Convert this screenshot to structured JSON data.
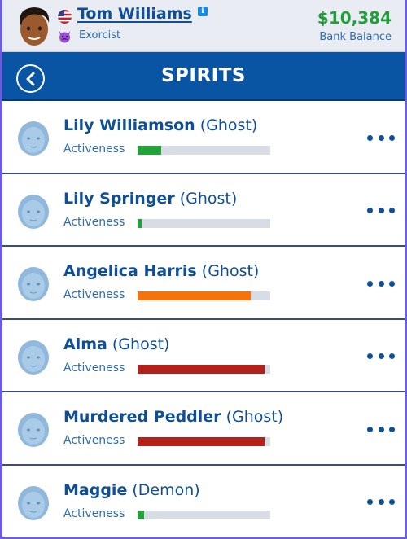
{
  "profile": {
    "name": "Tom Williams",
    "job": "Exorcist",
    "info_icon": "i",
    "flag_icon": "us-flag-icon",
    "job_icon": "devil-emoji-icon",
    "balance": "$10,384",
    "balance_label": "Bank Balance"
  },
  "header": {
    "title": "SPIRITS",
    "back_icon": "chevron-left-circle-icon"
  },
  "colors": {
    "brand_blue": "#0a55a3",
    "text_blue": "#0f4f96",
    "money_green": "#239c3a",
    "bar_green": "#22a33a",
    "bar_orange": "#f5730a",
    "bar_red": "#b3211b",
    "bar_track": "#d8dce4"
  },
  "spirits": [
    {
      "name": "Lily Williamson",
      "type": "(Ghost)",
      "activeness_label": "Activeness",
      "activeness_pct": 18,
      "bar_color": "#22a33a"
    },
    {
      "name": "Lily Springer",
      "type": "(Ghost)",
      "activeness_label": "Activeness",
      "activeness_pct": 3,
      "bar_color": "#22a33a"
    },
    {
      "name": "Angelica Harris",
      "type": "(Ghost)",
      "activeness_label": "Activeness",
      "activeness_pct": 85,
      "bar_color": "#f5730a"
    },
    {
      "name": "Alma",
      "type": "(Ghost)",
      "activeness_label": "Activeness",
      "activeness_pct": 96,
      "bar_color": "#b3211b"
    },
    {
      "name": "Murdered Peddler",
      "type": "(Ghost)",
      "activeness_label": "Activeness",
      "activeness_pct": 96,
      "bar_color": "#b3211b"
    },
    {
      "name": "Maggie",
      "type": "(Demon)",
      "activeness_label": "Activeness",
      "activeness_pct": 5,
      "bar_color": "#22a33a"
    }
  ]
}
